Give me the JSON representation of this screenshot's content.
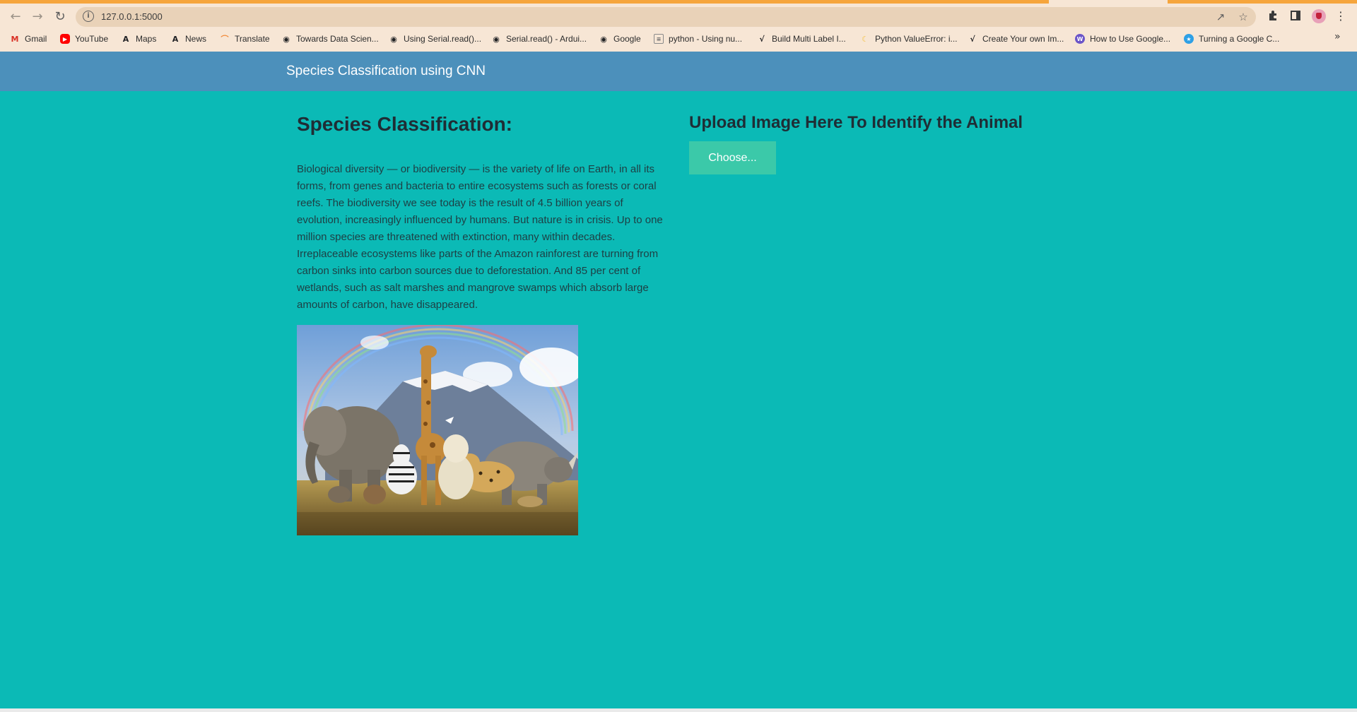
{
  "browser": {
    "url": "127.0.0.1:5000",
    "bookmarks": [
      {
        "label": "Gmail",
        "icon": "gmail-icon"
      },
      {
        "label": "YouTube",
        "icon": "youtube-icon"
      },
      {
        "label": "Maps",
        "icon": "maps-icon"
      },
      {
        "label": "News",
        "icon": "news-icon"
      },
      {
        "label": "Translate",
        "icon": "translate-icon"
      },
      {
        "label": "Towards Data Scien...",
        "icon": "globe-icon"
      },
      {
        "label": "Using Serial.read()...",
        "icon": "globe-icon"
      },
      {
        "label": "Serial.read() - Ardui...",
        "icon": "globe-icon"
      },
      {
        "label": "Google",
        "icon": "globe-icon"
      },
      {
        "label": "python - Using nu...",
        "icon": "stackoverflow-icon"
      },
      {
        "label": "Build Multi Label I...",
        "icon": "chart-icon"
      },
      {
        "label": "Python ValueError: i...",
        "icon": "moon-icon"
      },
      {
        "label": "Create Your own Im...",
        "icon": "chart-icon"
      },
      {
        "label": "How to Use Google...",
        "icon": "site-icon"
      },
      {
        "label": "Turning a Google C...",
        "icon": "star-site-icon"
      }
    ]
  },
  "navbar": {
    "brand": "Species Classification using CNN"
  },
  "main": {
    "title": "Species Classification:",
    "description": "Biological diversity — or biodiversity — is the variety of life on Earth, in all its forms, from genes and bacteria to entire ecosystems such as forests or coral reefs. The biodiversity we see today is the result of 4.5 billion years of evolution, increasingly influenced by humans. But nature is in crisis. Up to one million species are threatened with extinction, many within decades. Irreplaceable ecosystems like parts of the Amazon rainforest are turning from carbon sinks into carbon sources due to deforestation. And 85 per cent of wetlands, such as salt marshes and mangrove swamps which absorb large amounts of carbon, have disappeared."
  },
  "upload": {
    "title": "Upload Image Here To Identify the Animal",
    "button_label": "Choose..."
  },
  "colors": {
    "page_bg": "#0bbab6",
    "navbar_bg": "#4c90bb",
    "button_bg": "#3bc9a9"
  }
}
